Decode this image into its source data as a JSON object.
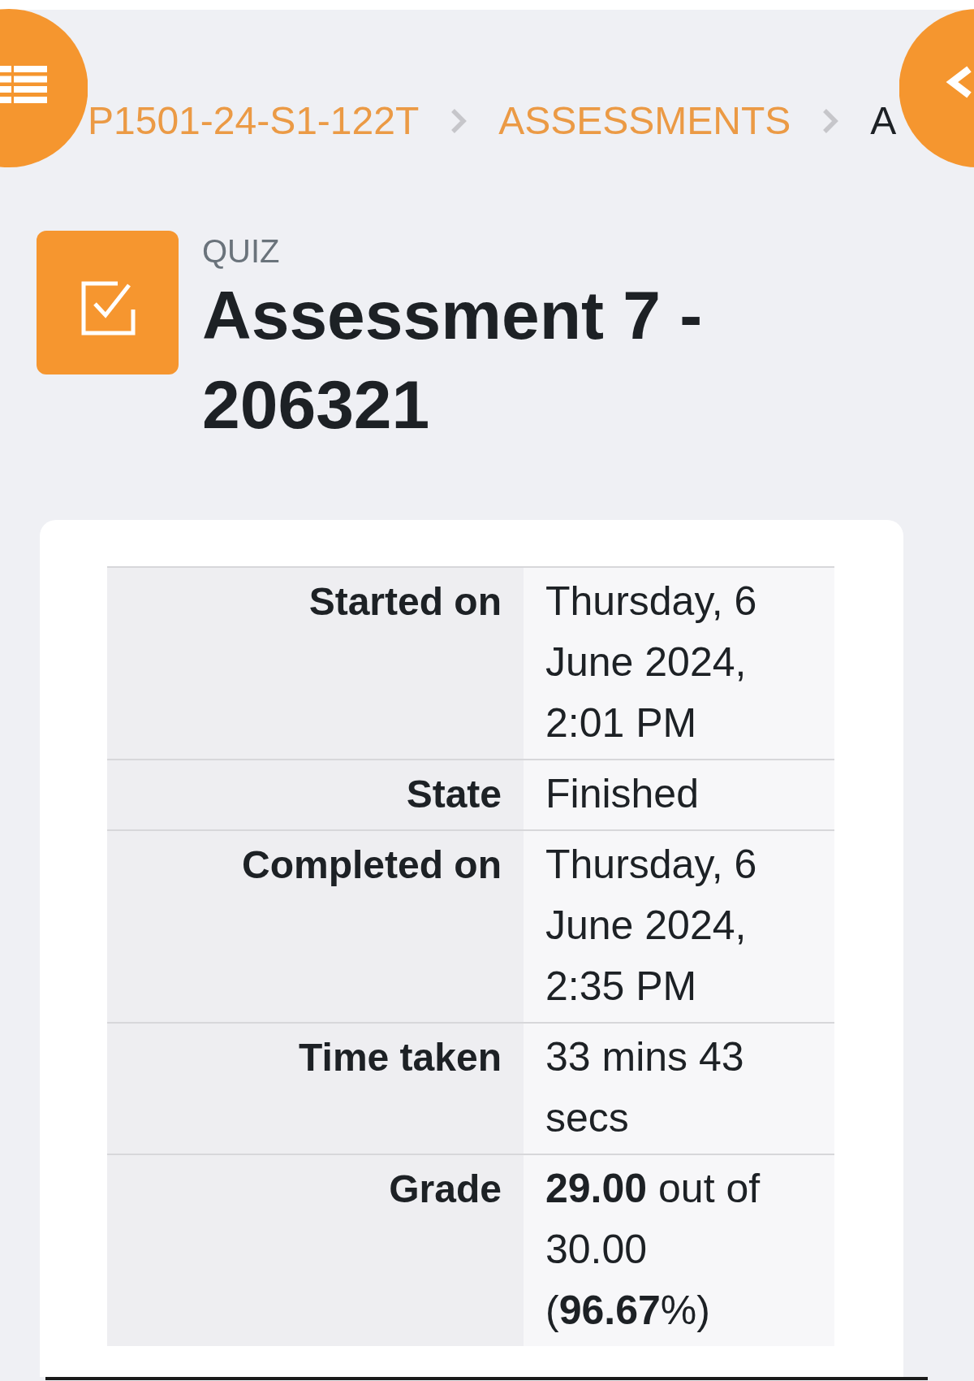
{
  "breadcrumb": [
    {
      "label": "P1501-24-S1-122T",
      "kind": "link"
    },
    {
      "label": "ASSESSMENTS",
      "kind": "link"
    },
    {
      "label": "A",
      "kind": "current"
    }
  ],
  "page_header": {
    "activity_type": "QUIZ",
    "title": "Assessment 7 - 206321"
  },
  "attempt_summary": [
    {
      "label": "Started on",
      "value": "Thursday, 6 June 2024, 2:01 PM"
    },
    {
      "label": "State",
      "value": "Finished"
    },
    {
      "label": "Completed on",
      "value": "Thursday, 6 June 2024, 2:35 PM"
    },
    {
      "label": "Time taken",
      "value": "33 mins 43 secs"
    },
    {
      "label": "Grade",
      "value": "**29.00** out of 30.00 (**96.67**%)"
    }
  ]
}
